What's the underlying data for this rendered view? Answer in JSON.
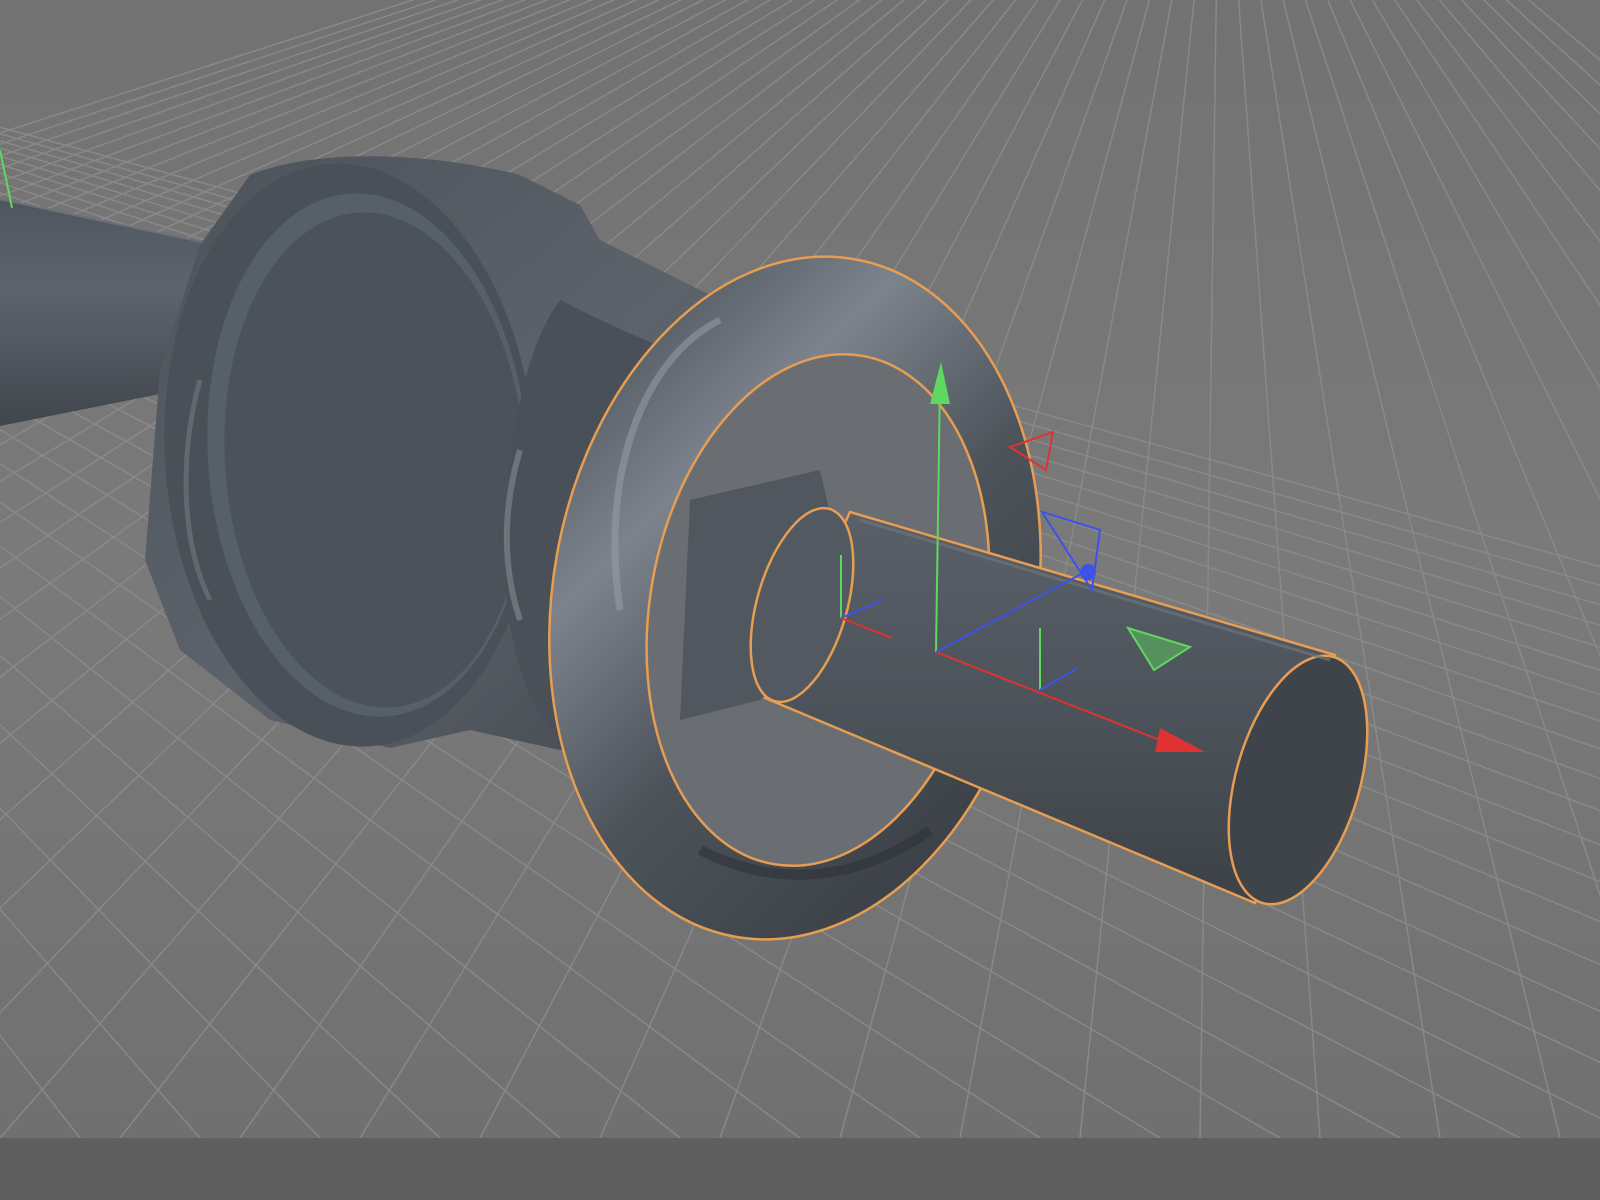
{
  "app": {
    "title": ""
  },
  "viewport": {
    "background_color": "#767676",
    "grid_color": "#8b8b8b",
    "selection_outline_color": "#e79d52",
    "axis_colors": {
      "x": "#e03232",
      "y": "#5ed85e",
      "z": "#3e52e8"
    }
  },
  "scene": {
    "objects": [
      {
        "name_semantic": "shaft-object",
        "selected": false
      },
      {
        "name_semantic": "hub-object",
        "selected": false
      },
      {
        "name_semantic": "torus-object",
        "selected": true
      },
      {
        "name_semantic": "pin-cylinder-object",
        "selected": true
      }
    ]
  },
  "manipulator": {
    "icon": "move-gizmo-icon"
  },
  "bottom_bar": {
    "label": ""
  }
}
